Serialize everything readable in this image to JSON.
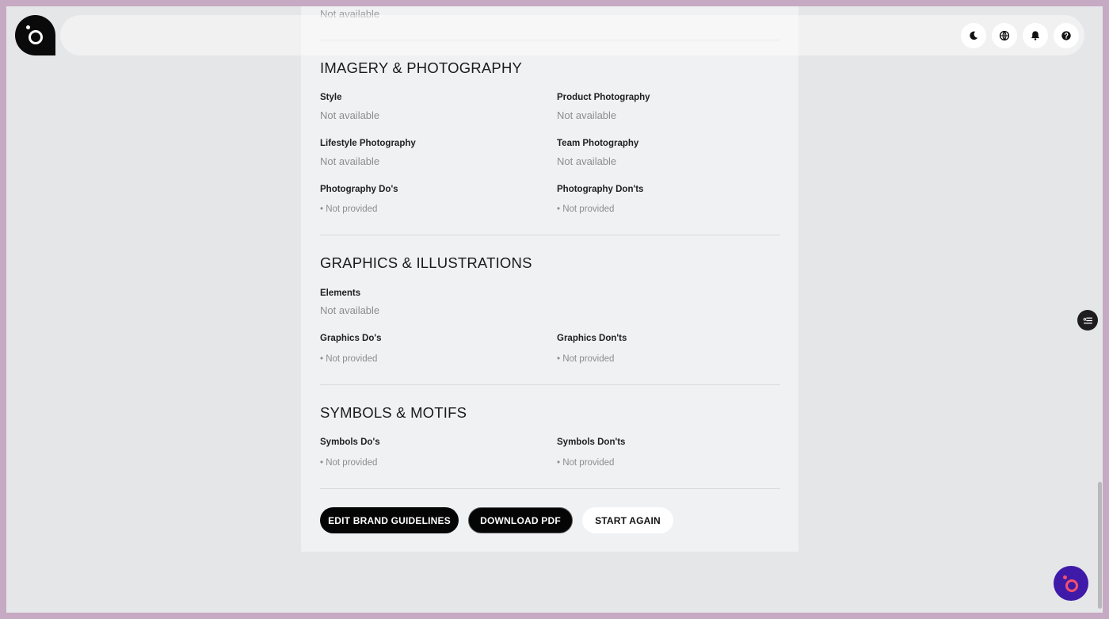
{
  "header": {
    "icons": [
      "moon-icon",
      "globe-icon",
      "bell-icon",
      "help-icon"
    ]
  },
  "top_fragment": {
    "value": "Not available"
  },
  "sections": {
    "imagery": {
      "title": "IMAGERY & PHOTOGRAPHY",
      "style_label": "Style",
      "style_value": "Not available",
      "product_label": "Product Photography",
      "product_value": "Not available",
      "lifestyle_label": "Lifestyle Photography",
      "lifestyle_value": "Not available",
      "team_label": "Team Photography",
      "team_value": "Not available",
      "dos_label": "Photography Do's",
      "dos_value": "• Not provided",
      "donts_label": "Photography Don'ts",
      "donts_value": "• Not provided"
    },
    "graphics": {
      "title": "GRAPHICS & ILLUSTRATIONS",
      "elements_label": "Elements",
      "elements_value": "Not available",
      "dos_label": "Graphics Do's",
      "dos_value": "• Not provided",
      "donts_label": "Graphics Don'ts",
      "donts_value": "• Not provided"
    },
    "symbols": {
      "title": "SYMBOLS & MOTIFS",
      "dos_label": "Symbols Do's",
      "dos_value": "• Not provided",
      "donts_label": "Symbols Don'ts",
      "donts_value": "• Not provided"
    }
  },
  "actions": {
    "edit_label": "EDIT BRAND GUIDELINES",
    "download_label": "DOWNLOAD PDF",
    "restart_label": "START AGAIN"
  },
  "colors": {
    "frame": "#c6a9c2",
    "background": "#e5e6e8",
    "card": "#f0f1f3",
    "fab": "#3f1aa8",
    "fab_accent": "#f4516c"
  }
}
